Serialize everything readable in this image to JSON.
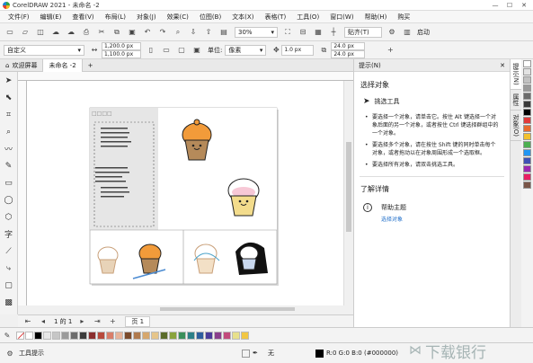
{
  "window": {
    "title": "CorelDRAW 2021 - 未命名 -2"
  },
  "menu": [
    "文件(F)",
    "编辑(E)",
    "查看(V)",
    "布局(L)",
    "对象(J)",
    "效果(C)",
    "位图(B)",
    "文本(X)",
    "表格(T)",
    "工具(O)",
    "窗口(W)",
    "帮助(H)",
    "购买"
  ],
  "toolbar": {
    "zoom": "30%",
    "snap_label": "贴齐(T)",
    "launch_label": "启动"
  },
  "propertybar": {
    "preset": "自定义",
    "width": "1,200.0 px",
    "height": "1,100.0 px",
    "unit_label": "单位:",
    "unit": "像素",
    "nudge": "1.0 px",
    "dup_x": "24.0 px",
    "dup_y": "24.0 px"
  },
  "tabs": [
    "欢迎屏幕",
    "未命名 -2"
  ],
  "pagebar": {
    "page_of": "1 的 1",
    "page_tab": "页 1"
  },
  "status": {
    "left": "工具提示",
    "fill": "无",
    "color_readout": "R:0 G:0 B:0 (#000000)"
  },
  "docker": {
    "header": "提示(N)",
    "title": "选择对象",
    "tool": "挑选工具",
    "tips": [
      "要选择一个对象，请单击它。按住 Alt 键选择一个对象后面的另一个对象，或者按住 Ctrl 键选择群组中的一个对象。",
      "要选择多个对象，请在按住 Shift 键的同时单击每个对象，或者拖动以在对象周围形成一个选取框。",
      "要选择所有对象，请双击挑选工具。"
    ],
    "learn_more": "了解详情",
    "help_topic": "帮助主题",
    "help_link": "选择对象"
  },
  "side_tabs": [
    "提示(N)",
    "属性",
    "对象(O)"
  ],
  "canvas": {
    "panel_title": "□□□□"
  },
  "palette_colors": [
    "#ffffff",
    "#000000",
    "#e8e8e8",
    "#c6c6c6",
    "#9b9b9b",
    "#6d6d6d",
    "#3c3c3c",
    "#8b2f2f",
    "#b84a3d",
    "#d97e6a",
    "#e7b39a",
    "#7b4a2b",
    "#b07a4d",
    "#d6a76d",
    "#e6c58a",
    "#5a6b2a",
    "#8aa33d",
    "#3b8f5a",
    "#2c7f87",
    "#2e5e9e",
    "#4b3c9a",
    "#8a3f8c",
    "#c24b7b",
    "#e7e08b",
    "#f2c744"
  ],
  "side_colors": [
    "#ffffff",
    "#e3e3e3",
    "#c2c2c2",
    "#9a9a9a",
    "#6b6b6b",
    "#3a3a3a",
    "#000000",
    "#e23a3a",
    "#e96b2e",
    "#f2c12e",
    "#4caf50",
    "#2196f3",
    "#3f51b5",
    "#9c27b0",
    "#e91e63",
    "#795548"
  ],
  "watermark": "下载银行"
}
